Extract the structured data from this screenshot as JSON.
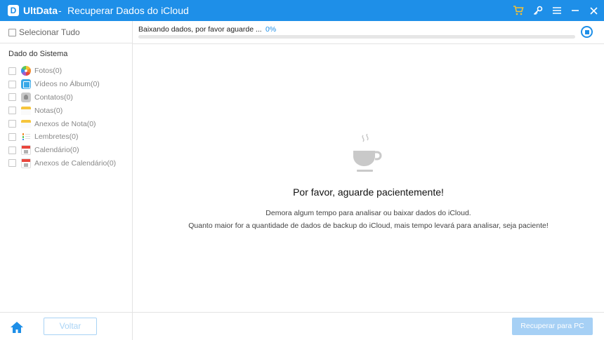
{
  "window": {
    "app_name": "UltData",
    "separator": "-",
    "title": "Recuperar Dados do iCloud",
    "logo_letter": "D",
    "accent_color": "#1e8fe8",
    "icons": [
      "cart-icon",
      "key-icon",
      "menu-icon",
      "minimize-icon",
      "close-icon"
    ]
  },
  "sidebar": {
    "select_all_label": "Selecionar Tudo",
    "section_title": "Dado do Sistema",
    "items": [
      {
        "label": "Fotos(0)",
        "icon": "photos-icon"
      },
      {
        "label": "Vídeos no Álbum(0)",
        "icon": "video-album-icon"
      },
      {
        "label": "Contatos(0)",
        "icon": "contacts-icon"
      },
      {
        "label": "Notas(0)",
        "icon": "notes-icon"
      },
      {
        "label": "Anexos de Nota(0)",
        "icon": "note-attachments-icon"
      },
      {
        "label": "Lembretes(0)",
        "icon": "reminders-icon"
      },
      {
        "label": "Calendário(0)",
        "icon": "calendar-icon"
      },
      {
        "label": "Anexos de Calendário(0)",
        "icon": "calendar-attachments-icon"
      }
    ]
  },
  "progress": {
    "label": "Baixando dados, por favor aguarde ...",
    "percent_text": "0%",
    "fraction": 0
  },
  "main": {
    "wait_title": "Por favor, aguarde pacientemente!",
    "wait_line1": "Demora algum tempo para analisar ou baixar dados do iCloud.",
    "wait_line2": "Quanto maior for a quantidade de dados de backup do iCloud, mais tempo levará para analisar, seja paciente!"
  },
  "footer": {
    "back_label": "Voltar",
    "recover_label": "Recuperar para PC"
  }
}
